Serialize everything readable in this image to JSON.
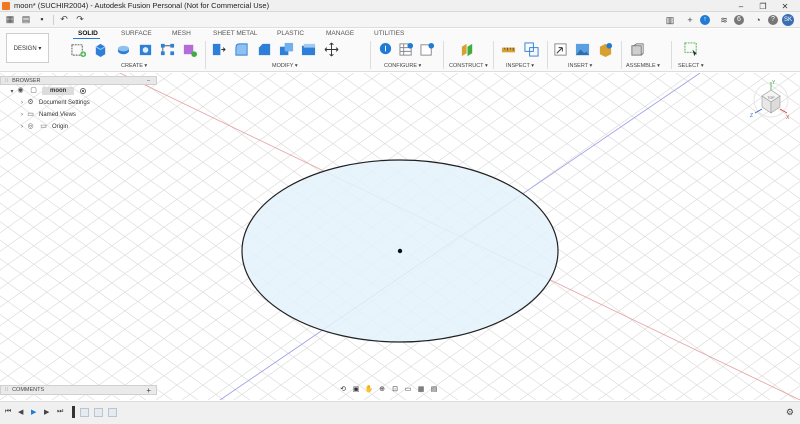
{
  "window": {
    "title": "moon* (SUCHIR2004) - Autodesk Fusion Personal (Not for Commercial Use)",
    "minimize": "–",
    "maximize": "❐",
    "close": "✕"
  },
  "quickbar": {
    "user_initials": "SK",
    "help": "?",
    "notifications": "6"
  },
  "toolbar": {
    "workspace_label": "DESIGN ▾",
    "tabs": [
      "SOLID",
      "SURFACE",
      "MESH",
      "SHEET METAL",
      "PLASTIC",
      "MANAGE",
      "UTILITIES"
    ],
    "active_tab": "SOLID",
    "groups": {
      "create": "CREATE ▾",
      "modify": "MODIFY ▾",
      "configure": "CONFIGURE ▾",
      "construct": "CONSTRUCT ▾",
      "inspect": "INSPECT ▾",
      "insert": "INSERT ▾",
      "assemble": "ASSEMBLE ▾",
      "select": "SELECT ▾"
    }
  },
  "browser": {
    "header": "BROWSER",
    "collapse": "–",
    "items": [
      {
        "label": "moon"
      },
      {
        "label": "Document Settings"
      },
      {
        "label": "Named Views"
      },
      {
        "label": "Origin"
      }
    ]
  },
  "comments": {
    "header": "COMMENTS",
    "add": "+"
  },
  "viewcube": {
    "face": "TOP",
    "axis_x": "X",
    "axis_y": "Y",
    "axis_z": "Z"
  },
  "colors": {
    "accent": "#1f7bd6",
    "sketch_fill": "#e4f2fa",
    "sketch_stroke": "#222222",
    "grid": "#d6d6d6",
    "axis_red": "#e07070",
    "axis_blue": "#6a6ad8"
  }
}
